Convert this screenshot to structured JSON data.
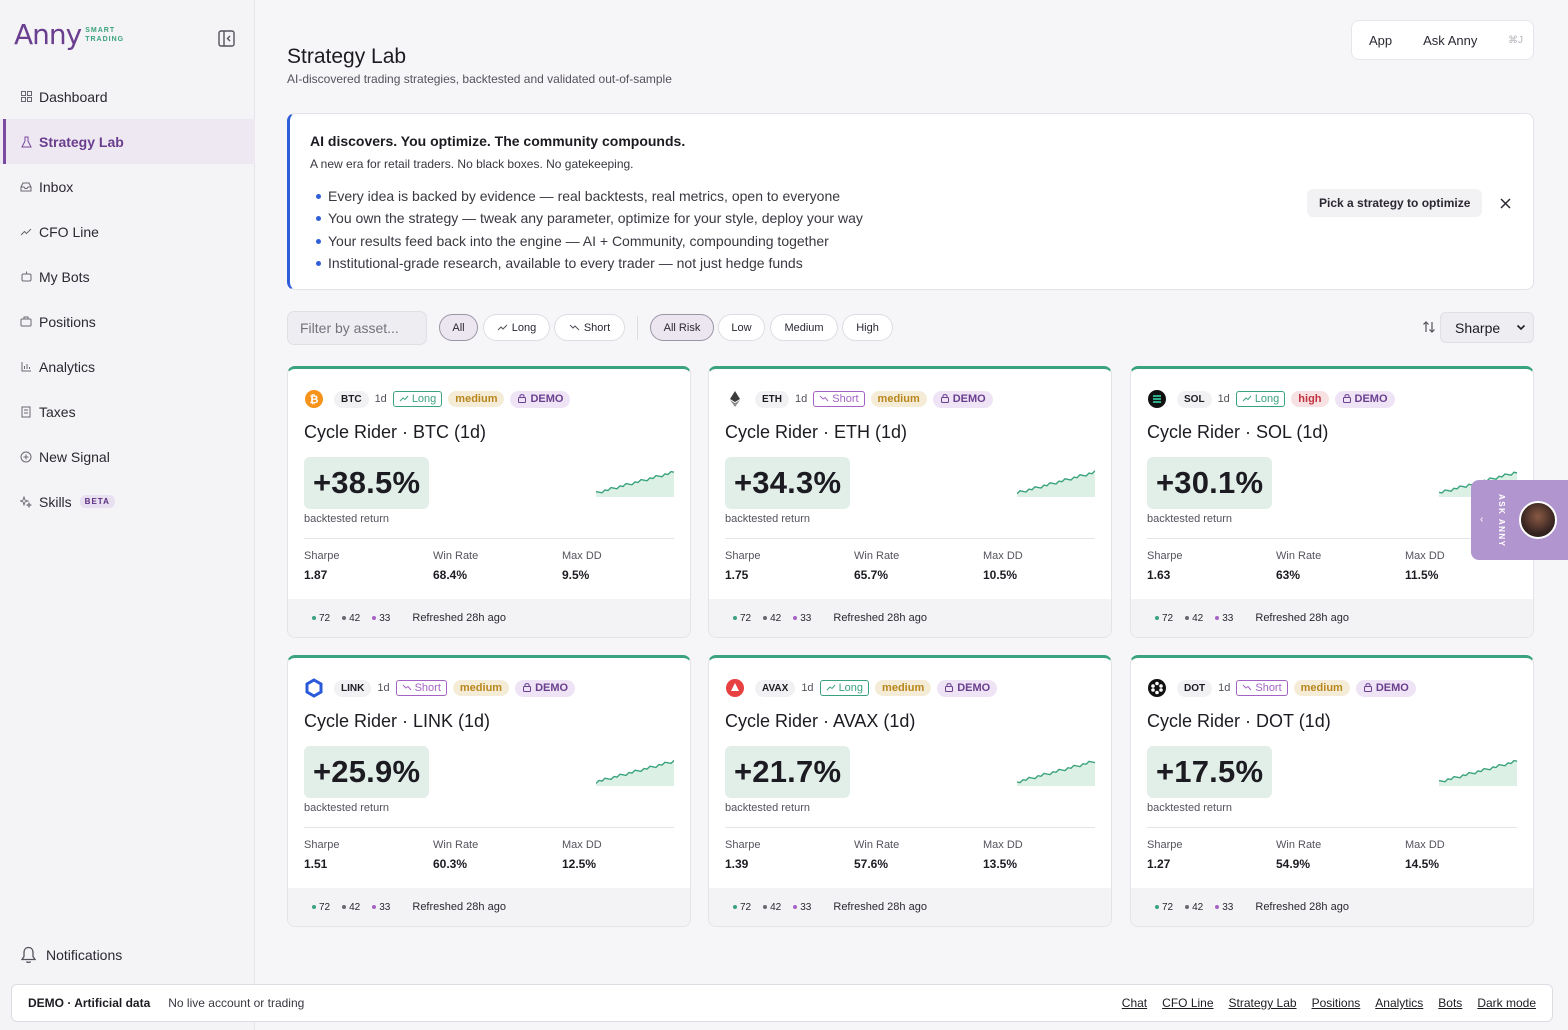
{
  "brand": {
    "name": "Anny",
    "tagline_line1": "SMART",
    "tagline_line2": "TRADING"
  },
  "sidebar": {
    "items": [
      {
        "label": "Dashboard",
        "icon": "grid-icon"
      },
      {
        "label": "Strategy Lab",
        "icon": "flask-icon",
        "active": true
      },
      {
        "label": "Inbox",
        "icon": "inbox-icon"
      },
      {
        "label": "CFO Line",
        "icon": "trend-icon"
      },
      {
        "label": "My Bots",
        "icon": "bot-icon"
      },
      {
        "label": "Positions",
        "icon": "briefcase-icon"
      },
      {
        "label": "Analytics",
        "icon": "bar-chart-icon"
      },
      {
        "label": "Taxes",
        "icon": "receipt-icon"
      },
      {
        "label": "New Signal",
        "icon": "plus-circle-icon"
      },
      {
        "label": "Skills",
        "icon": "sparkle-icon",
        "badge": "BETA"
      }
    ],
    "notifications_label": "Notifications"
  },
  "topbar": {
    "app_label": "App",
    "ask_label": "Ask Anny",
    "shortcut": "⌘J"
  },
  "header": {
    "title": "Strategy Lab",
    "subtitle": "AI-discovered trading strategies, backtested and validated out-of-sample"
  },
  "banner": {
    "title": "AI discovers. You optimize. The community compounds.",
    "subtitle": "A new era for retail traders. No black boxes. No gatekeeping.",
    "bullets": [
      "Every idea is backed by evidence — real backtests, real metrics, open to everyone",
      "You own the strategy — tweak any parameter, optimize for your style, deploy your way",
      "Your results feed back into the engine — AI + Community, compounding together",
      "Institutional-grade research, available to every trader — not just hedge funds"
    ],
    "cta": "Pick a strategy to optimize"
  },
  "filters": {
    "placeholder": "Filter by asset...",
    "direction": [
      "All",
      "Long",
      "Short"
    ],
    "risk": [
      "All Risk",
      "Low",
      "Medium",
      "High"
    ],
    "sort_value": "Sharpe"
  },
  "cards": [
    {
      "ticker": "BTC",
      "tf": "1d",
      "dir": "Long",
      "risk": "medium",
      "demo": "DEMO",
      "title": "Cycle Rider · BTC (1d)",
      "ret": "+38.5%",
      "ret_label": "backtested return",
      "sharpe_label": "Sharpe",
      "sharpe": "1.87",
      "win_label": "Win Rate",
      "win": "68.4%",
      "dd_label": "Max DD",
      "dd": "9.5%",
      "c1": "72",
      "c2": "42",
      "c3": "33",
      "refreshed": "Refreshed 28h ago"
    },
    {
      "ticker": "ETH",
      "tf": "1d",
      "dir": "Short",
      "risk": "medium",
      "demo": "DEMO",
      "title": "Cycle Rider · ETH (1d)",
      "ret": "+34.3%",
      "ret_label": "backtested return",
      "sharpe_label": "Sharpe",
      "sharpe": "1.75",
      "win_label": "Win Rate",
      "win": "65.7%",
      "dd_label": "Max DD",
      "dd": "10.5%",
      "c1": "72",
      "c2": "42",
      "c3": "33",
      "refreshed": "Refreshed 28h ago"
    },
    {
      "ticker": "SOL",
      "tf": "1d",
      "dir": "Long",
      "risk": "high",
      "demo": "DEMO",
      "title": "Cycle Rider · SOL (1d)",
      "ret": "+30.1%",
      "ret_label": "backtested return",
      "sharpe_label": "Sharpe",
      "sharpe": "1.63",
      "win_label": "Win Rate",
      "win": "63%",
      "dd_label": "Max DD",
      "dd": "11.5%",
      "c1": "72",
      "c2": "42",
      "c3": "33",
      "refreshed": "Refreshed 28h ago"
    },
    {
      "ticker": "LINK",
      "tf": "1d",
      "dir": "Short",
      "risk": "medium",
      "demo": "DEMO",
      "title": "Cycle Rider · LINK (1d)",
      "ret": "+25.9%",
      "ret_label": "backtested return",
      "sharpe_label": "Sharpe",
      "sharpe": "1.51",
      "win_label": "Win Rate",
      "win": "60.3%",
      "dd_label": "Max DD",
      "dd": "12.5%",
      "c1": "72",
      "c2": "42",
      "c3": "33",
      "refreshed": "Refreshed 28h ago"
    },
    {
      "ticker": "AVAX",
      "tf": "1d",
      "dir": "Long",
      "risk": "medium",
      "demo": "DEMO",
      "title": "Cycle Rider · AVAX (1d)",
      "ret": "+21.7%",
      "ret_label": "backtested return",
      "sharpe_label": "Sharpe",
      "sharpe": "1.39",
      "win_label": "Win Rate",
      "win": "57.6%",
      "dd_label": "Max DD",
      "dd": "13.5%",
      "c1": "72",
      "c2": "42",
      "c3": "33",
      "refreshed": "Refreshed 28h ago"
    },
    {
      "ticker": "DOT",
      "tf": "1d",
      "dir": "Short",
      "risk": "medium",
      "demo": "DEMO",
      "title": "Cycle Rider · DOT (1d)",
      "ret": "+17.5%",
      "ret_label": "backtested return",
      "sharpe_label": "Sharpe",
      "sharpe": "1.27",
      "win_label": "Win Rate",
      "win": "54.9%",
      "dd_label": "Max DD",
      "dd": "14.5%",
      "c1": "72",
      "c2": "42",
      "c3": "33",
      "refreshed": "Refreshed 28h ago"
    }
  ],
  "ask_tab": {
    "label": "ASK ANNY"
  },
  "bottombar": {
    "demo": "DEMO · Artificial data",
    "note": "No live account or trading",
    "links": [
      "Chat",
      "CFO Line",
      "Strategy Lab",
      "Positions",
      "Analytics",
      "Bots",
      "Dark mode"
    ]
  },
  "colors": {
    "accent": "#6a3f8f",
    "positive": "#3aa37d",
    "info": "#2f5fd8"
  }
}
